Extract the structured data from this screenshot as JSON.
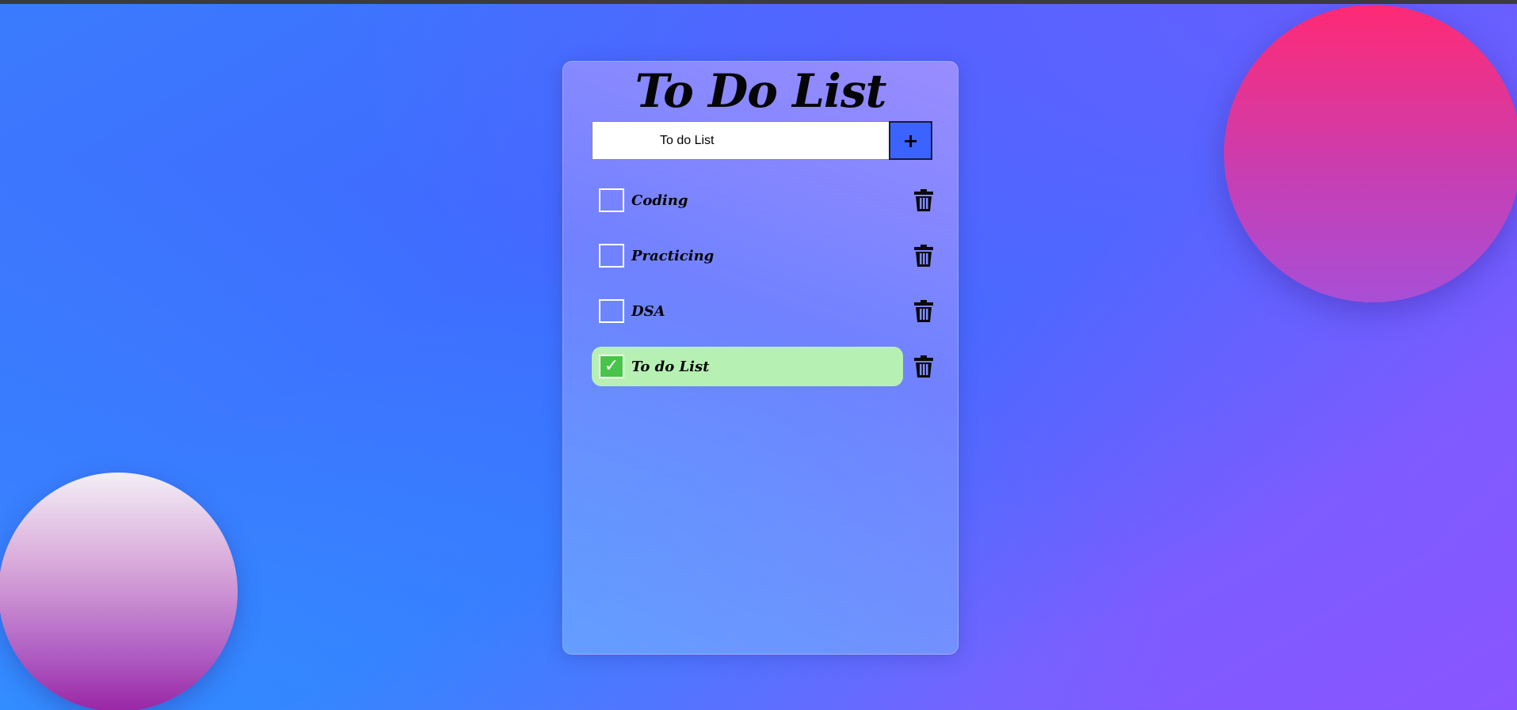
{
  "app": {
    "title": "To Do List"
  },
  "input": {
    "value": "To do List",
    "add_label": "+"
  },
  "tasks": [
    {
      "label": "Coding",
      "done": false
    },
    {
      "label": "Practicing",
      "done": false
    },
    {
      "label": "DSA",
      "done": false
    },
    {
      "label": "To do List",
      "done": true
    }
  ],
  "icons": {
    "delete": "trash-icon",
    "check": "checkmark-icon"
  },
  "colors": {
    "done_row": "#b7f0b3",
    "checked_box": "#49c44a",
    "add_button": "#3b63ff"
  }
}
